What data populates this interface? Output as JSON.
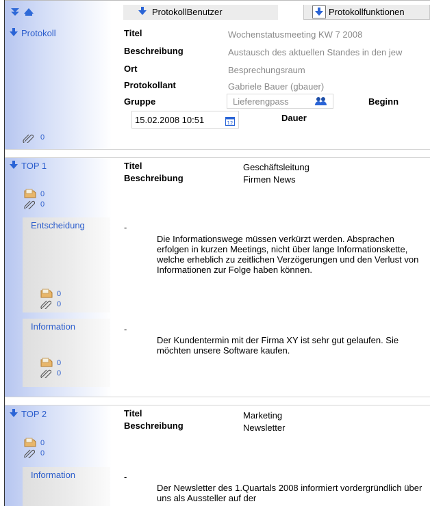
{
  "toolbar": {
    "tab1": "ProtokollBenutzer",
    "tab2": "Protokollfunktionen"
  },
  "header": {
    "section_label": "Protokoll",
    "attachment_count": "0",
    "fields": {
      "titel_label": "Titel",
      "titel_value": "Wochenstatusmeeting KW 7 2008",
      "beschreibung_label": "Beschreibung",
      "beschreibung_value": "Austausch des aktuellen Standes in den jew",
      "ort_label": "Ort",
      "ort_value": "Besprechungsraum",
      "protokollant_label": "Protokollant",
      "protokollant_value": "Gabriele Bauer (gbauer)",
      "gruppe_label": "Gruppe",
      "gruppe_value": "Lieferengpass",
      "beginn_label": "Beginn",
      "beginn_value": "15.02.2008 10:51",
      "dauer_label": "Dauer"
    }
  },
  "top1": {
    "label": "TOP 1",
    "titel_label": "Titel",
    "titel_value": "Geschäftsleitung",
    "beschreibung_label": "Beschreibung",
    "beschreibung_value": "Firmen News",
    "note_count": "0",
    "attach_count": "0",
    "entscheidung": {
      "label": "Entscheidung",
      "dash": "-",
      "text": "Die Informationswege müssen verkürzt werden. Absprachen erfolgen in kurzen Meetings, nicht über lange Informationskette, welche erheblich zu zeitlichen Verzögerungen und den Verlust von Informationen zur Folge haben können.",
      "note_count": "0",
      "attach_count": "0"
    },
    "information": {
      "label": "Information",
      "dash": "-",
      "text": "Der Kundentermin mit der Firma XY ist sehr gut gelaufen. Sie möchten unsere Software kaufen.",
      "note_count": "0",
      "attach_count": "0"
    }
  },
  "top2": {
    "label": "TOP 2",
    "titel_label": "Titel",
    "titel_value": "Marketing",
    "beschreibung_label": "Beschreibung",
    "beschreibung_value": "Newsletter",
    "note_count": "0",
    "attach_count": "0",
    "information": {
      "label": "Information",
      "dash": "-",
      "text": "Der Newsletter des 1.Quartals 2008 informiert vordergründlich über uns als Aussteller auf der"
    }
  }
}
